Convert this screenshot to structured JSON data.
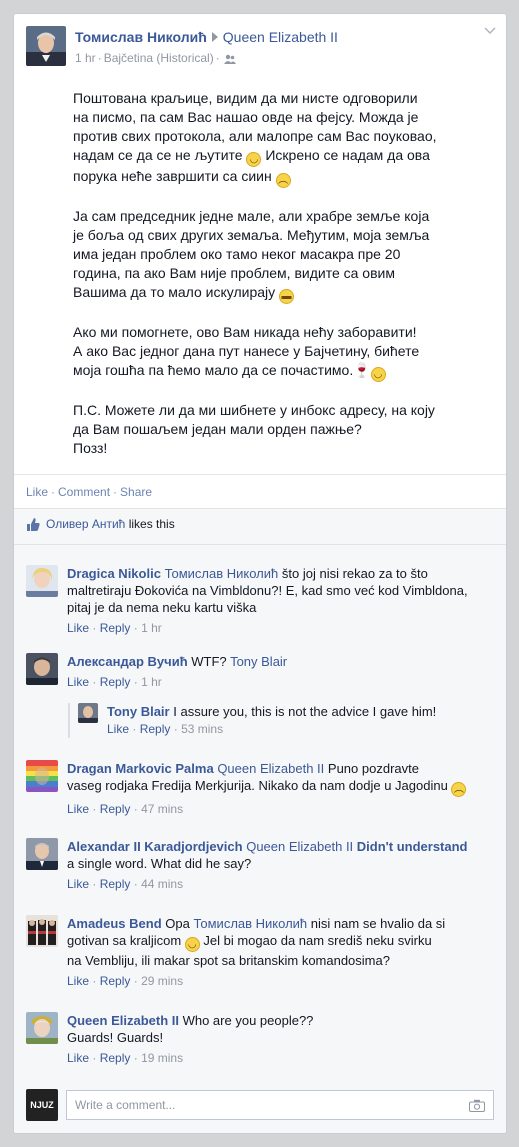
{
  "post": {
    "author": "Томислав Николић",
    "recipient": "Queen Elizabeth II",
    "time": "1 hr",
    "location": "Bajčetina (Historical)",
    "paragraphs": [
      {
        "text": "Поштована краљице, видим да ми нисте одговорили\nна писмо, па сам Вас нашао овде на фејсу. Можда је\nпротив свих протокола, али малопре сам Вас поуковао,\nнадам се да се не љутите",
        "mid": " Искрено се надам да ова\nпорука неће завршити са сиин",
        "end": ""
      },
      {
        "text": "Ја сам председник једне мале, али храбре земље која\nје боља од свих других земаља. Међутим, моја земља\nима један проблем око тамо неког масакра пре 20\nгодина, па ако Вам није проблем, видите са овим\nВашима да то мало искулирају",
        "mid": "",
        "end": ""
      },
      {
        "text": "Ако ми помогнете, ово Вам никада нећу заборавити!\nА ако Вас једног дана пут нанесе у Бајчетину, бићете\nмоја гошћа па ћемо мало да се почастимо.",
        "mid": "",
        "end": ""
      },
      {
        "text": "П.С. Можете ли да ми шибнете у инбокс адресу, на коју\nда Вам пошаљем један мали орден пажње?\nПозз!",
        "mid": "",
        "end": ""
      }
    ]
  },
  "actions": {
    "like": "Like",
    "comment": "Comment",
    "share": "Share",
    "dot": "·"
  },
  "likes": {
    "name": "Оливер Антић",
    "suffix": "likes this"
  },
  "comments": [
    {
      "author": "Dragica Nikolic",
      "tag": "Томислав Николић",
      "text": "što joj nisi rekao za to što\nmaltretiraju Đokovića na Vimbldonu?! E, kad smo već kod Vimbldona,\npitaj je da nema neku kartu viška",
      "time": "1 hr"
    },
    {
      "author": "Александар Вучић",
      "text": "WTF?",
      "tag": "Tony Blair",
      "time": "1 hr"
    },
    {
      "author": "Tony Blair",
      "text": "I assure you, this is not the advice I gave him!",
      "time": "53 mins"
    },
    {
      "author": "Dragan Markovic Palma",
      "tag": "Queen Elizabeth II",
      "text": "Puno pozdravte\nvaseg rodjaka Fredija Merkjurija. Nikako da nam dodje u Jagodinu",
      "time": "47 mins"
    },
    {
      "author": "Alexandar II Karadjordjevich",
      "tag": "Queen Elizabeth II",
      "tag2": "Didn't understand",
      "text": "a single word. What did he say?",
      "time": "44 mins"
    },
    {
      "author": "Amadeus Bend",
      "pre": "Opa",
      "tag": "Томислав Николић",
      "text": "nisi nam se hvalio da si\ngotivan sa kraljicom",
      "text2": " Jel bi mogao da nam središ neku svirku\nna Vembliju, ili makar spot sa britanskim komandosima?",
      "time": "29 mins"
    },
    {
      "author": "Queen Elizabeth II",
      "text": "Who are you people??\nGuards! Guards!",
      "time": "19 mins"
    }
  ],
  "comment_meta": {
    "like": "Like",
    "reply": "Reply",
    "dot": "·"
  },
  "composer": {
    "placeholder": "Write a comment...",
    "badge": "NJUZ"
  },
  "colors": {
    "link": "#3b5998",
    "muted": "#9197a3",
    "background": "#d3d4d6"
  }
}
